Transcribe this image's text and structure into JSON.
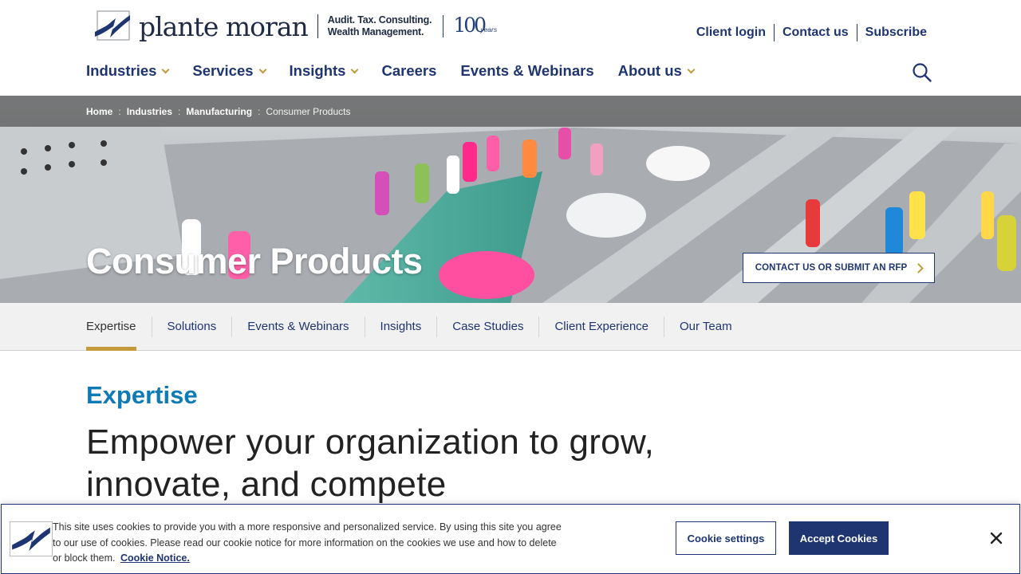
{
  "brand": {
    "name": "plante moran",
    "tagline_line1": "Audit. Tax. Consulting.",
    "tagline_line2": "Wealth Management.",
    "centennial_number": "100",
    "centennial_word": "years",
    "logo_icon": "plante-moran-mark"
  },
  "utility_nav": {
    "client_login": "Client login",
    "contact_us": "Contact us",
    "subscribe": "Subscribe"
  },
  "main_nav": {
    "items": [
      {
        "label": "Industries",
        "has_menu": true
      },
      {
        "label": "Services",
        "has_menu": true
      },
      {
        "label": "Insights",
        "has_menu": true
      },
      {
        "label": "Careers",
        "has_menu": false
      },
      {
        "label": "Events & Webinars",
        "has_menu": false
      },
      {
        "label": "About us",
        "has_menu": true
      }
    ],
    "search_icon": "search-icon"
  },
  "breadcrumb": {
    "items": [
      "Home",
      "Industries",
      "Manufacturing"
    ],
    "separator": ":",
    "current": "Consumer Products"
  },
  "hero": {
    "title": "Consumer Products",
    "cta_label": "CONTACT US OR SUBMIT AN RFP"
  },
  "subtabs": {
    "items": [
      "Expertise",
      "Solutions",
      "Events & Webinars",
      "Insights",
      "Case Studies",
      "Client Experience",
      "Our Team"
    ],
    "active": "Expertise"
  },
  "main": {
    "section_heading": "Expertise",
    "lead_line1": "Empower your organization to grow,",
    "lead_line2": "innovate, and compete"
  },
  "cookie_banner": {
    "text": "This site uses cookies to provide you with a more responsive and personalized service. By using this site you agree to our use of cookies. Please read our cookie notice for more information on the cookies we use and how to delete or block them.",
    "link_label": "Cookie Notice.",
    "settings_label": "Cookie settings",
    "accept_label": "Accept Cookies",
    "close_icon": "close-icon"
  },
  "colors": {
    "navy": "#1f3572",
    "gold": "#c49a3a",
    "teal_heading": "#0e7bb6",
    "tab_bar_bg": "#f1f1f1"
  }
}
